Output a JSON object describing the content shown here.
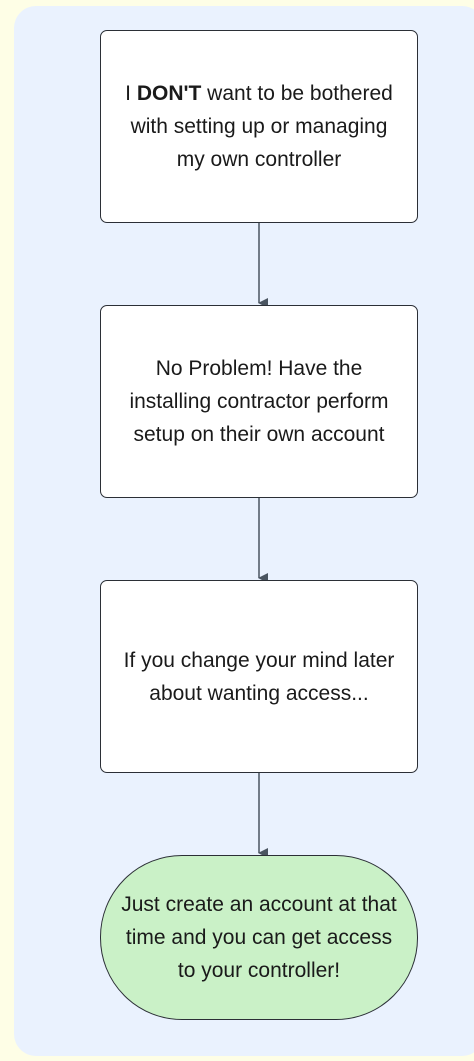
{
  "nodes": {
    "n1": {
      "pre": "I ",
      "strong": "DON'T",
      "post": " want to be bothered with setting up or managing my own controller"
    },
    "n2": {
      "text": "No Problem! Have the installing contractor perform setup on their own account"
    },
    "n3": {
      "text": "If you change your mind later about wanting access..."
    },
    "n4": {
      "text": "Just create an account at that time and you can get access to your controller!"
    }
  },
  "colors": {
    "page_background": "#fefee6",
    "canvas_background": "#eaf2fe",
    "box_fill": "#ffffff",
    "terminal_fill": "#caf1c7",
    "stroke": "#2b2f36",
    "arrow": "#4a5560"
  },
  "edges": [
    {
      "from": "n1",
      "to": "n2"
    },
    {
      "from": "n2",
      "to": "n3"
    },
    {
      "from": "n3",
      "to": "n4"
    }
  ]
}
